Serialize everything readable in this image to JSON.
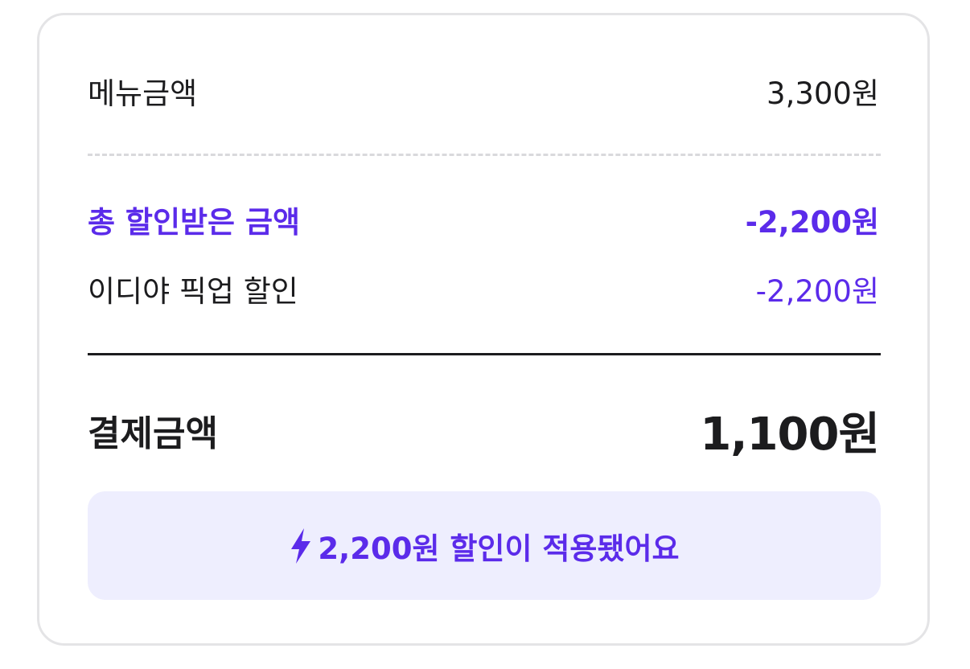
{
  "summary": {
    "menu_label": "메뉴금액",
    "menu_amount": "3,300원",
    "total_discount_label": "총 할인받은 금액",
    "total_discount_amount": "-2,200원",
    "pickup_discount_label": "이디야 픽업 할인",
    "pickup_discount_amount": "-2,200원",
    "payment_label": "결제금액",
    "payment_amount": "1,100원"
  },
  "banner": {
    "icon": "lightning-bolt-icon",
    "text": "2,200원 할인이 적용됐어요"
  },
  "colors": {
    "accent": "#5b2bea",
    "banner_bg": "#eeeefe",
    "text": "#1c1c1e",
    "border": "#e4e4e6"
  }
}
